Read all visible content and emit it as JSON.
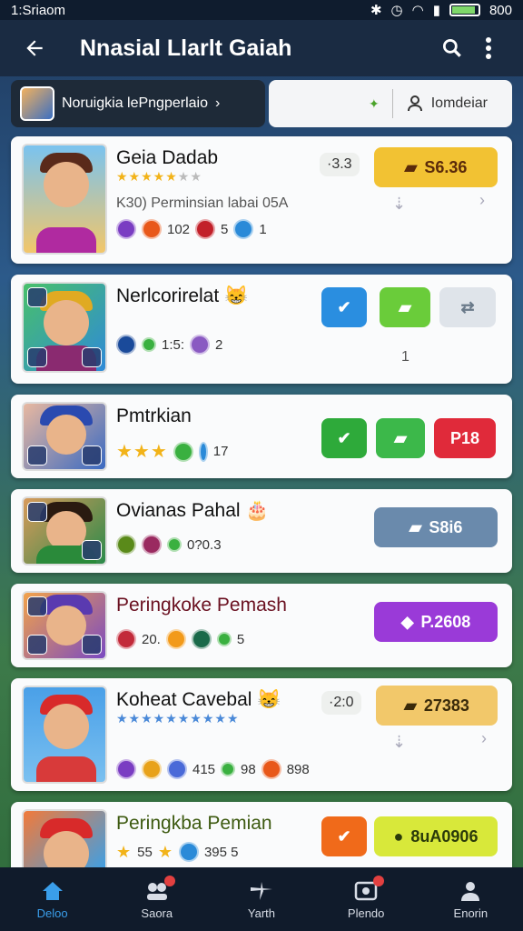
{
  "status": {
    "left": "1:Sriaom",
    "right": "800",
    "battery_level": 0.9
  },
  "header": {
    "title": "Nnasial Llarlt Gaiah",
    "back_icon": "arrow-left-icon",
    "search_icon": "search-icon",
    "more_icon": "more-vert-icon"
  },
  "subbar": {
    "profile_label": "Noruigkia lePngperlaio",
    "filter_label": "Iomdeiar"
  },
  "cards": [
    {
      "name": "Geia Dadab",
      "stars": "★★★★★",
      "stars_dim": "★★",
      "score": "·3.3",
      "meta": "K30)  Perminsian labai  05A",
      "badge1": "102",
      "badge2": "5",
      "badge3": "1",
      "price": "S6.36",
      "price_color": "#f2c233"
    },
    {
      "name": "Nerlcorirelat",
      "emoji": "😸",
      "badge1": "1:5:",
      "badge2": "2",
      "count": "1"
    },
    {
      "name": "Pmtrkian",
      "badge1": "17",
      "action": "P18"
    },
    {
      "name": "Ovianas Pahal",
      "badge1": "0?0.3",
      "price": "S8i6"
    },
    {
      "name": "Peringkoke Pemash",
      "badge1": "20.",
      "badge2": "5",
      "price": "P.2608"
    },
    {
      "name": "Koheat Cavebal",
      "emoji": "😸",
      "stars": "★★★★★★★★★★",
      "score": "·2:0",
      "badge1": "415",
      "badge2": "98",
      "badge3": "898",
      "price": "27383"
    },
    {
      "name": "Peringkba Pemian",
      "badge1": "55",
      "badge2": "395 5",
      "price": "8uA0906"
    }
  ],
  "nav": [
    {
      "label": "Deloo",
      "icon": "home-icon",
      "active": true
    },
    {
      "label": "Saora",
      "icon": "group-icon"
    },
    {
      "label": "Yarth",
      "icon": "plane-icon"
    },
    {
      "label": "Plendo",
      "icon": "media-icon"
    },
    {
      "label": "Enorin",
      "icon": "person-icon"
    }
  ]
}
